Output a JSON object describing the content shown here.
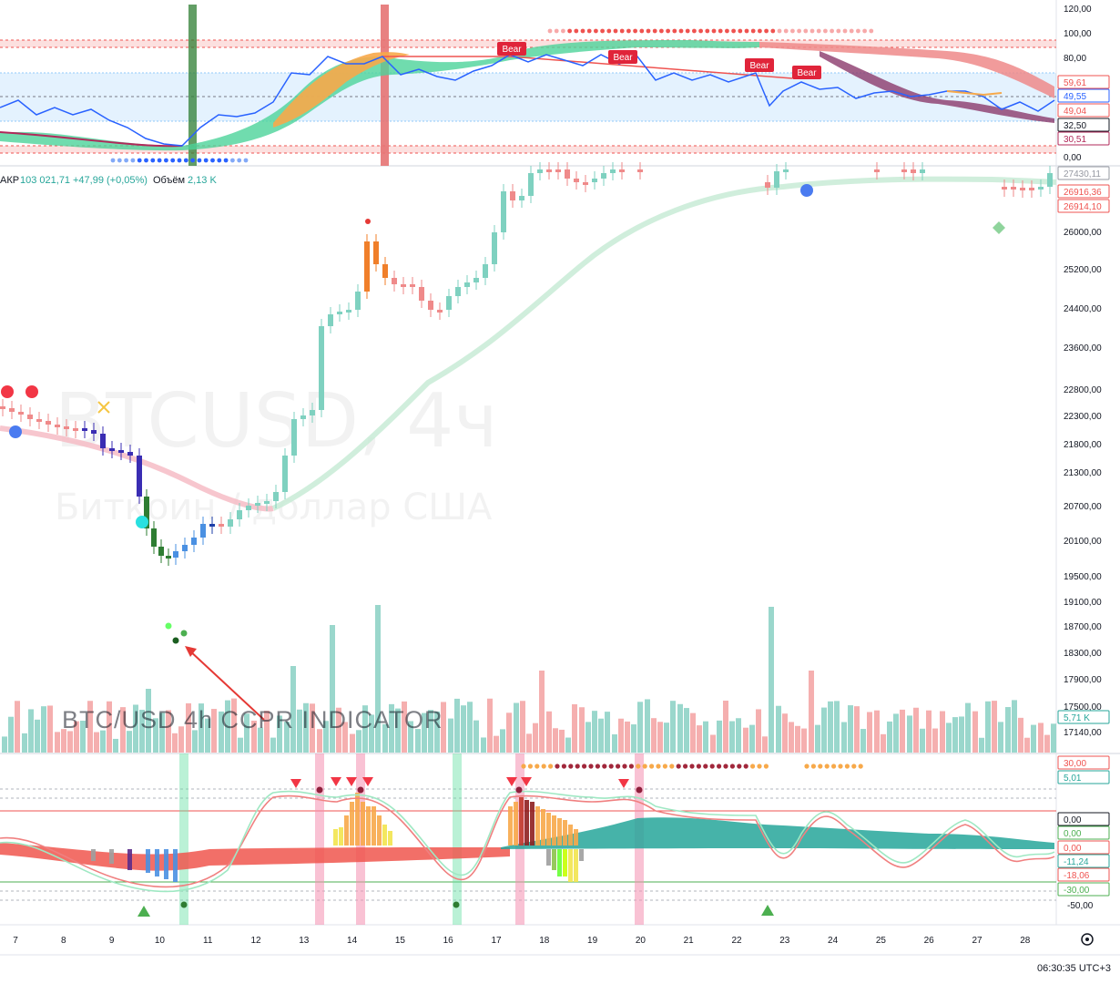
{
  "chart_data": [
    {
      "type": "line",
      "panel": "oscillator-top",
      "y_ticks": [
        "120,00",
        "100,00",
        "80,00",
        "0,00"
      ],
      "ylim": [
        0,
        120
      ],
      "band_range": [
        32.5,
        80
      ],
      "marker_labels": [
        "Bear",
        "Bear",
        "Bear",
        "Bear"
      ],
      "value_tags": [
        {
          "label": "59,61",
          "color": "#ef5350"
        },
        {
          "label": "49,55",
          "color": "#2962ff"
        },
        {
          "label": "49,04",
          "color": "#ef5350"
        },
        {
          "label": "32,50",
          "color": "#131722"
        },
        {
          "label": "30,51",
          "color": "#b2285a"
        }
      ]
    },
    {
      "type": "candlestick",
      "panel": "price",
      "symbol_info": {
        "prefix": "АКР",
        "price": "103 021,71",
        "change": "+47,99 (+0,05%)",
        "volume_label": "Объём",
        "volume": "2,13 K"
      },
      "watermark": {
        "symbol": "BTCUSD, 4ч",
        "name": "Биткоин / доллар США"
      },
      "annotation": "BTC/USD 4h   CCPR INDICATOR",
      "y_ticks": [
        "26000,00",
        "25200,00",
        "24400,00",
        "23600,00",
        "22800,00",
        "22300,00",
        "21800,00",
        "21300,00",
        "20700,00",
        "20100,00",
        "19500,00",
        "19100,00",
        "18700,00",
        "18300,00",
        "17900,00",
        "17500,00",
        "17140,00"
      ],
      "ylim": [
        17140,
        27430
      ],
      "value_tags": [
        {
          "label": "27430,11",
          "color": "#9598a1"
        },
        {
          "label": "26916,36",
          "color": "#ef5350"
        },
        {
          "label": "26914,10",
          "color": "#ef5350"
        }
      ],
      "volume_tag": {
        "label": "5,71 K",
        "color": "#26a69a"
      }
    },
    {
      "type": "area",
      "panel": "oscillator-bottom",
      "y_ticks": [
        "-50,00"
      ],
      "ylim": [
        -50,
        30
      ],
      "value_tags": [
        {
          "label": "30,00",
          "color": "#ef5350"
        },
        {
          "label": "5,01",
          "color": "#26a69a"
        },
        {
          "label": "0,00",
          "color": "#131722"
        },
        {
          "label": "0,00",
          "color": "#4caf50"
        },
        {
          "label": "0,00",
          "color": "#ef5350"
        },
        {
          "label": "-11,24",
          "color": "#26a69a"
        },
        {
          "label": "-18,06",
          "color": "#ef5350"
        },
        {
          "label": "-30,00",
          "color": "#4caf50"
        }
      ]
    }
  ],
  "time_axis": {
    "labels": [
      "7",
      "8",
      "9",
      "10",
      "11",
      "12",
      "13",
      "14",
      "15",
      "16",
      "17",
      "18",
      "19",
      "20",
      "21",
      "22",
      "23",
      "24",
      "25",
      "26",
      "27",
      "28"
    ]
  },
  "clock": "06:30:35 UTC+3",
  "colors": {
    "up": "#26a69a",
    "down": "#ef5350",
    "accent": "#2962ff"
  }
}
